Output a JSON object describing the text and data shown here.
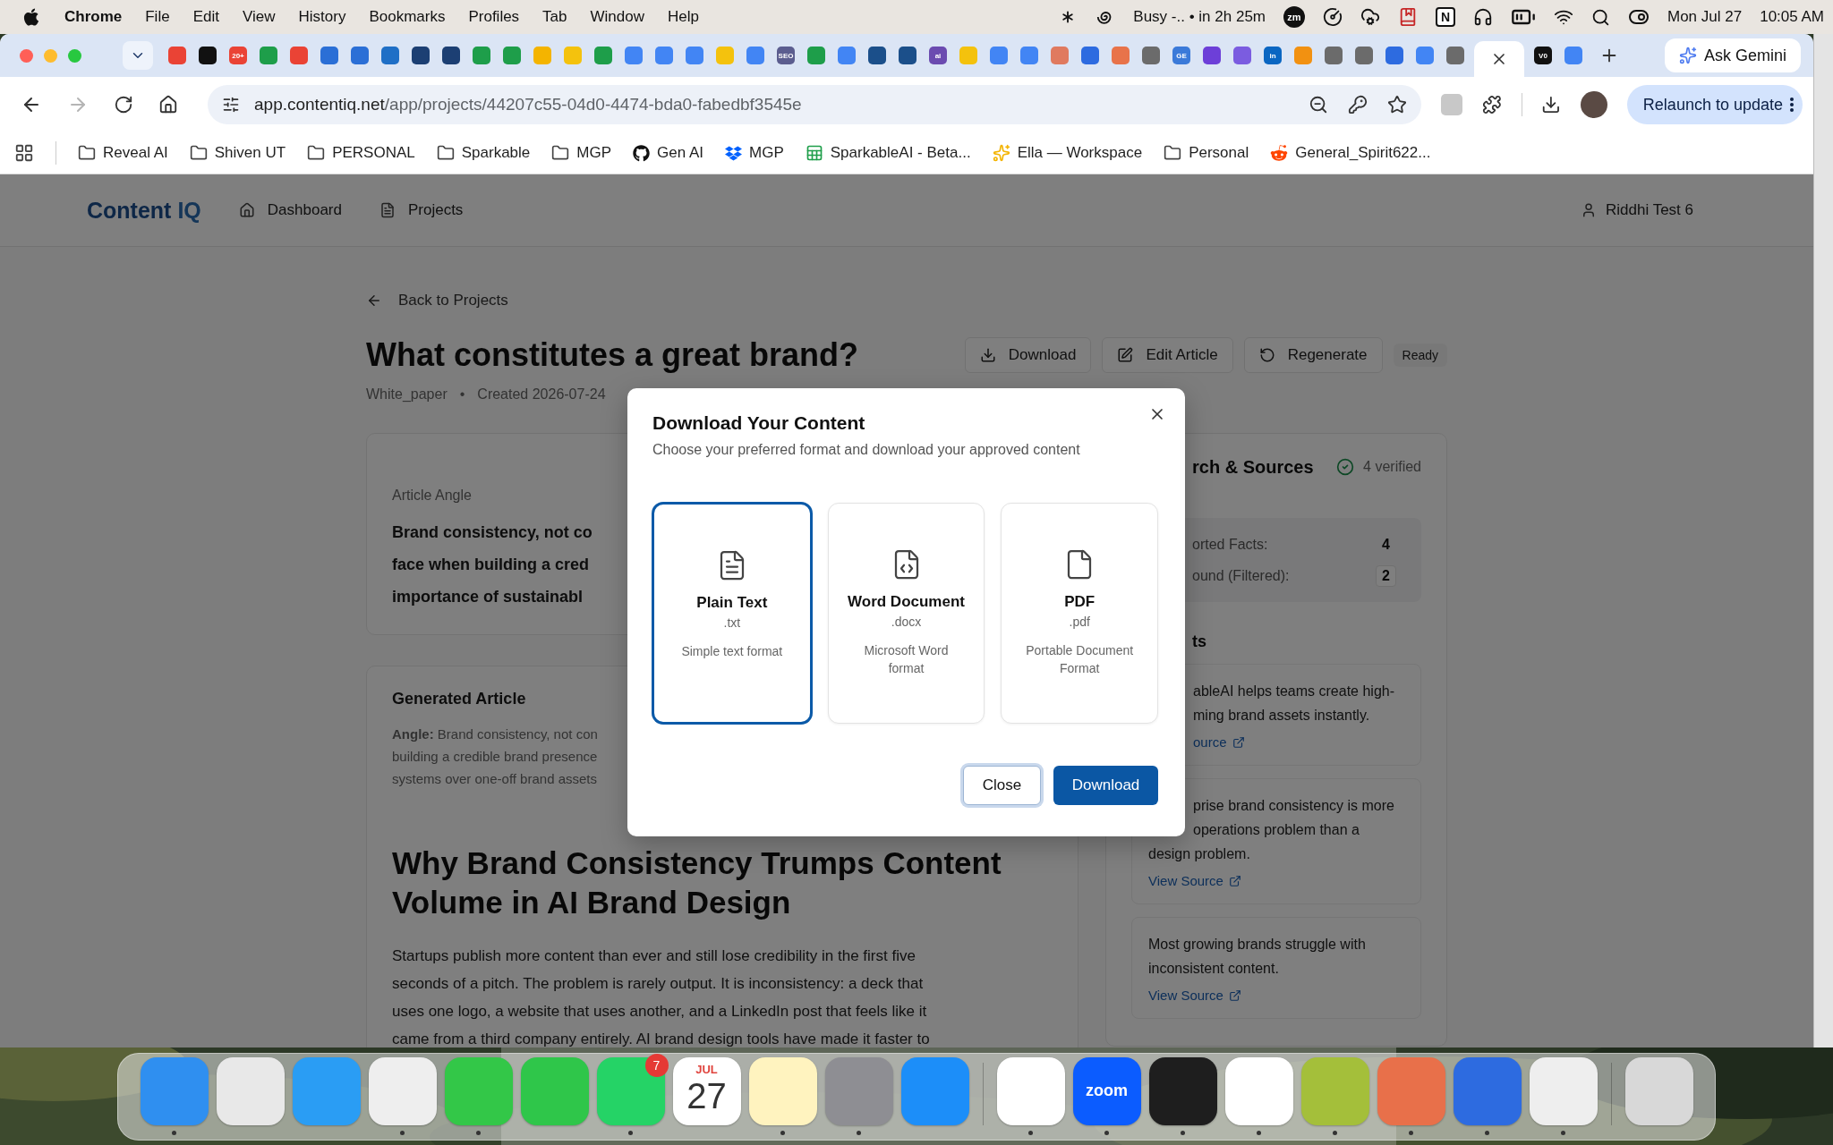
{
  "menubar": {
    "app": "Chrome",
    "menus": [
      "File",
      "Edit",
      "View",
      "History",
      "Bookmarks",
      "Profiles",
      "Tab",
      "Window",
      "Help"
    ],
    "busy_status": "Busy -.. • in 2h 25m",
    "zoom_badge": "zm",
    "notion_glyph": "N",
    "date": "Mon Jul 27",
    "time": "10:05 AM"
  },
  "tabs": [
    {
      "color": "#ea4335",
      "selected": false
    },
    {
      "color": "#111111",
      "selected": false
    },
    {
      "color": "#ea4335",
      "text": "20+",
      "selected": false
    },
    {
      "color": "#1e9e4a",
      "selected": false
    },
    {
      "color": "#ea4335",
      "selected": false
    },
    {
      "color": "#2b6fd6",
      "selected": false
    },
    {
      "color": "#2b6fd6",
      "selected": false
    },
    {
      "color": "#1f6fc6",
      "selected": false
    },
    {
      "color": "#1c3f73",
      "selected": false
    },
    {
      "color": "#1c3f73",
      "selected": false
    },
    {
      "color": "#1e9e4a",
      "selected": false
    },
    {
      "color": "#1e9e4a",
      "selected": false
    },
    {
      "color": "#f4b400",
      "selected": false
    },
    {
      "color": "#f4c20d",
      "selected": false
    },
    {
      "color": "#1e9e4a",
      "selected": false
    },
    {
      "color": "#4285f4",
      "selected": false
    },
    {
      "color": "#4285f4",
      "selected": false
    },
    {
      "color": "#4285f4",
      "selected": false
    },
    {
      "color": "#f4c20d",
      "selected": false
    },
    {
      "color": "#4285f4",
      "selected": false
    },
    {
      "color": "#5b5d8f",
      "text": "SEO",
      "selected": false
    },
    {
      "color": "#1e9e4a",
      "selected": false
    },
    {
      "color": "#4285f4",
      "selected": false
    },
    {
      "color": "#1b4f8a",
      "selected": false
    },
    {
      "color": "#1b4f8a",
      "selected": false
    },
    {
      "color": "#6b4bb0",
      "text": "ai",
      "selected": false
    },
    {
      "color": "#f4c20d",
      "selected": false
    },
    {
      "color": "#4285f4",
      "selected": false
    },
    {
      "color": "#4285f4",
      "selected": false
    },
    {
      "color": "#e07a5f",
      "selected": false
    },
    {
      "color": "#2d6be0",
      "selected": false
    },
    {
      "color": "#e8734a",
      "selected": false
    },
    {
      "color": "#6b6b6b",
      "selected": false
    },
    {
      "color": "#3b7ad9",
      "text": "GE",
      "selected": false
    },
    {
      "color": "#6d3fd8",
      "selected": false
    },
    {
      "color": "#7b5ce0",
      "selected": false
    },
    {
      "color": "#0a66c2",
      "text": "in",
      "selected": false
    },
    {
      "color": "#f29111",
      "selected": false
    },
    {
      "color": "#6b6b6b",
      "selected": false
    },
    {
      "color": "#6b6b6b",
      "selected": false
    },
    {
      "color": "#2d6be0",
      "selected": false
    },
    {
      "color": "#4285f4",
      "selected": false
    },
    {
      "color": "#6b6b6b",
      "selected": false
    },
    {
      "selected": true
    },
    {
      "color": "#111111",
      "text": "V0",
      "selected": false
    },
    {
      "color": "#4285f4",
      "selected": false
    }
  ],
  "gemini_button": "Ask Gemini",
  "toolbar": {
    "url_host": "app.contentiq.net",
    "url_path": "/app/projects/44207c55-04d0-4474-bda0-fabedbf3545e",
    "forward_disabled": true,
    "relaunch_button": "Relaunch to update"
  },
  "bookmarks": [
    {
      "kind": "folder",
      "label": "Reveal AI"
    },
    {
      "kind": "folder",
      "label": "Shiven UT"
    },
    {
      "kind": "folder",
      "label": "PERSONAL"
    },
    {
      "kind": "folder",
      "label": "Sparkable"
    },
    {
      "kind": "folder",
      "label": "MGP"
    },
    {
      "kind": "github",
      "label": "Gen AI"
    },
    {
      "kind": "dropbox",
      "label": "MGP"
    },
    {
      "kind": "sheet",
      "label": "SparkableAI - Beta..."
    },
    {
      "kind": "spark",
      "label": "Ella — Workspace"
    },
    {
      "kind": "folder",
      "label": "Personal"
    },
    {
      "kind": "reddit",
      "label": "General_Spirit622..."
    }
  ],
  "app": {
    "logo_main": "Content",
    "logo_accent": "IQ",
    "nav": [
      {
        "kind": "home",
        "label": "Dashboard"
      },
      {
        "kind": "file",
        "label": "Projects"
      }
    ],
    "user": "Riddhi Test 6"
  },
  "project": {
    "back_link": "Back to Projects",
    "title": "What constitutes a great brand?",
    "actions": [
      {
        "kind": "download",
        "label": "Download"
      },
      {
        "kind": "edit",
        "label": "Edit Article"
      },
      {
        "kind": "regenerate",
        "label": "Regenerate"
      }
    ],
    "status_badge": "Ready",
    "type": "White_paper",
    "separator": "•",
    "created": "Created 2026-07-24"
  },
  "angle_card": {
    "label": "Article Angle",
    "lines": [
      "Brand consistency, not co",
      "face when building a cred",
      "importance of sustainabl"
    ]
  },
  "article": {
    "title": "Generated Article",
    "angle_lines": [
      "**Angle:** Brand consistency, not con",
      "building a credible brand presence",
      "systems over one-off brand assets"
    ],
    "heading_lines": [
      "Why Brand Consistency Trumps Content",
      "Volume in AI Brand Design"
    ],
    "body_lines": [
      "Startups publish more content than ever and still lose credibility in the first five",
      "seconds of a pitch. The problem is rarely output. It is inconsistency: a deck that",
      "uses one logo, a website that uses another, and a LinkedIn post that feels like it",
      "came from a third company entirely. AI brand design tools have made it faster to"
    ]
  },
  "research": {
    "title": "rch & Sources",
    "verified": "4 verified",
    "stats": [
      {
        "kind": "plain",
        "label": "orted Facts:",
        "value": "4"
      },
      {
        "kind": "boxed",
        "label": "ound (Filtered):",
        "value": "2"
      }
    ],
    "facts_title": "ts",
    "facts": [
      {
        "lines": [
          "ableAI helps teams create high-",
          "ming brand assets instantly."
        ],
        "link": "ource"
      },
      {
        "lines": [
          "prise brand consistency is more",
          "operations problem than a",
          "design problem."
        ],
        "link": "View Source"
      },
      {
        "lines": [
          "Most growing brands struggle with",
          "inconsistent content."
        ],
        "link": "View Source"
      }
    ]
  },
  "dialog": {
    "title": "Download Your Content",
    "subtitle": "Choose your preferred format and download your approved content",
    "formats": [
      {
        "kind": "text",
        "name": "Plain Text",
        "ext": ".txt",
        "description": "Simple text format",
        "selected": true
      },
      {
        "kind": "code",
        "name": "Word Document",
        "ext": ".docx",
        "description": "Microsoft Word format",
        "selected": false
      },
      {
        "kind": "blank",
        "name": "PDF",
        "ext": ".pdf",
        "description": "Portable Document Format",
        "selected": false
      }
    ],
    "close_button": "Close",
    "download_button": "Download"
  },
  "dock": [
    {
      "kind": "app",
      "color": "#2f8ff0",
      "running": true
    },
    {
      "kind": "app",
      "color": "#e8e8e8",
      "running": false
    },
    {
      "kind": "app",
      "color": "#2a9df4",
      "running": false
    },
    {
      "kind": "app",
      "color": "#eeeeee",
      "running": true
    },
    {
      "kind": "app",
      "color": "#33c748",
      "running": true
    },
    {
      "kind": "app",
      "color": "#2fc64a",
      "running": false
    },
    {
      "kind": "app",
      "color": "#25d366",
      "badge": "7",
      "running": true
    },
    {
      "kind": "calendar",
      "color": "#ffffff",
      "month": "JUL",
      "day": "27",
      "running": false
    },
    {
      "kind": "app",
      "color": "#fff3bf",
      "running": true
    },
    {
      "kind": "app",
      "color": "#8e8e93",
      "running": true
    },
    {
      "kind": "app",
      "color": "#1c8ef9",
      "running": false
    },
    {
      "kind": "separator"
    },
    {
      "kind": "app",
      "color": "#ffffff",
      "running": true
    },
    {
      "kind": "app",
      "color": "#0b5cff",
      "label": "zoom",
      "running": true
    },
    {
      "kind": "app",
      "color": "#1e1e1e",
      "running": true
    },
    {
      "kind": "app",
      "color": "#ffffff",
      "running": true
    },
    {
      "kind": "app",
      "color": "#a4bf3a",
      "running": true
    },
    {
      "kind": "app",
      "color": "#e8704a",
      "running": true
    },
    {
      "kind": "app",
      "color": "#2d6be0",
      "running": true
    },
    {
      "kind": "app",
      "color": "#eeeeee",
      "running": true
    },
    {
      "kind": "separator"
    },
    {
      "kind": "app",
      "color": "#d8d8d8",
      "running": false
    }
  ]
}
